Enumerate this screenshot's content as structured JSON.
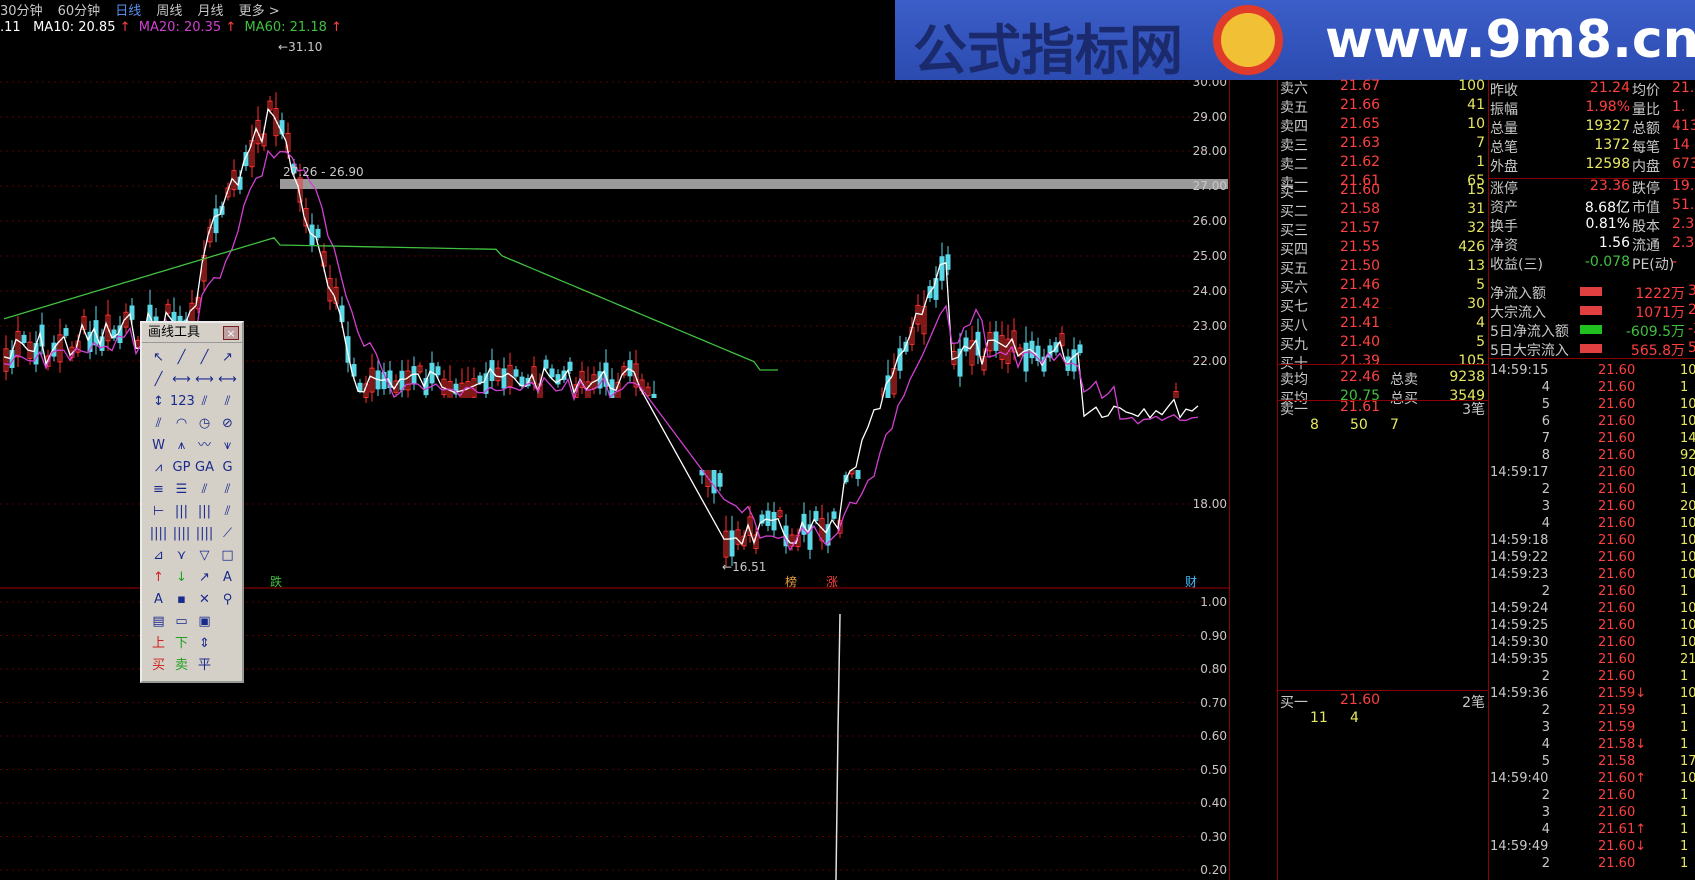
{
  "period_bar": {
    "items": [
      "30分钟",
      "60分钟",
      "日线",
      "周线",
      "月线",
      "更多 >"
    ],
    "active": "日线"
  },
  "ma_legend": {
    "lead": ".11",
    "ma10": "MA10: 20.85",
    "ma20": "MA20: 20.35",
    "ma60": "MA60: 21.18"
  },
  "chart_labels": {
    "high": "31.10",
    "range": "27.26 - 26.90",
    "low": "16.51",
    "mark_1": "跌",
    "mark_2": "榜",
    "mark_3": "涨",
    "mark_4": "财"
  },
  "price_axis": [
    "30.00",
    "29.00",
    "28.00",
    "27.00",
    "26.00",
    "25.00",
    "24.00",
    "23.00",
    "22.00",
    "18.00"
  ],
  "volume_axis": [
    "1.00",
    "0.90",
    "0.80",
    "0.70",
    "0.60",
    "0.50",
    "0.40",
    "0.30",
    "0.20"
  ],
  "banner": {
    "brand": "公式指标网",
    "site": "www.9m8.cn"
  },
  "toolbox": {
    "title": "画线工具",
    "close": "×",
    "tools": [
      "↖",
      "╱",
      "╱",
      "↗",
      "╱",
      "⟷",
      "⟷",
      "⟷",
      "↕",
      "123",
      "⫽",
      "⫽",
      "⫽",
      "◠",
      "◷",
      "⊘",
      "W",
      "⩚",
      "〰",
      "⩛",
      "⩘",
      "GP",
      "GA",
      "G",
      "≡",
      "☰",
      "⫽",
      "⫽",
      "⊢",
      "|||",
      "|||",
      "⫽",
      "||||",
      "||||",
      "||||",
      "⟋",
      "⊿",
      "⋎",
      "▽",
      "□",
      "↑",
      "↓",
      "↗",
      "A",
      "A",
      "▪",
      "✕",
      "⚲",
      "▤",
      "▭",
      "▣",
      "",
      "上",
      "下",
      "⇕",
      "",
      "买",
      "卖",
      "平",
      ""
    ]
  },
  "orderbook": {
    "asks": [
      [
        "卖六",
        "21.67",
        "100"
      ],
      [
        "卖五",
        "21.66",
        "41"
      ],
      [
        "卖四",
        "21.65",
        "10"
      ],
      [
        "卖三",
        "21.63",
        "7"
      ],
      [
        "卖二",
        "21.62",
        "1"
      ],
      [
        "卖一",
        "21.61",
        "65"
      ]
    ],
    "bids": [
      [
        "买一",
        "21.60",
        "15"
      ],
      [
        "买二",
        "21.58",
        "31"
      ],
      [
        "买三",
        "21.57",
        "32"
      ],
      [
        "买四",
        "21.55",
        "426"
      ],
      [
        "买五",
        "21.50",
        "13"
      ],
      [
        "买六",
        "21.46",
        "5"
      ],
      [
        "买七",
        "21.42",
        "30"
      ],
      [
        "买八",
        "21.41",
        "4"
      ],
      [
        "买九",
        "21.40",
        "5"
      ],
      [
        "买十",
        "21.39",
        "105"
      ]
    ],
    "avg_ask_label": "卖均",
    "avg_ask": "22.46",
    "total_ask_label": "总卖",
    "total_ask": "9238",
    "avg_bid_label": "买均",
    "avg_bid": "20.75",
    "total_bid_label": "总买",
    "total_bid": "3549",
    "queue1": {
      "label": "卖一",
      "price": "21.61",
      "count": "3笔",
      "detail": [
        "8",
        "50",
        "7"
      ]
    },
    "queue2": {
      "label": "买一",
      "price": "21.60",
      "count": "2笔",
      "detail": [
        "11",
        "4"
      ]
    }
  },
  "stats": [
    [
      "昨收",
      "21.24",
      "均价",
      "21.4"
    ],
    [
      "振幅",
      "1.98%",
      "量比",
      "1."
    ],
    [
      "总量",
      "19327",
      "总额",
      "4139"
    ],
    [
      "总笔",
      "1372",
      "每笔",
      "14"
    ],
    [
      "外盘",
      "12598",
      "内盘",
      "673"
    ],
    [
      "涨停",
      "23.36",
      "跌停",
      "19."
    ],
    [
      "资产",
      "8.68亿",
      "市值",
      "51.3"
    ],
    [
      "换手",
      "0.81%",
      "股本",
      "2.37"
    ],
    [
      "净资",
      "1.56",
      "流通",
      "2.37"
    ],
    [
      "收益(三)",
      "-0.078",
      "PE(动)",
      "-"
    ]
  ],
  "flows": [
    [
      "净流入额",
      "1222万",
      "30"
    ],
    [
      "大宗流入",
      "1071万",
      "26"
    ],
    [
      "5日净流入额",
      "-609.5万",
      "-3"
    ],
    [
      "5日大宗流入",
      "565.8万",
      "5"
    ]
  ],
  "ticks": [
    [
      "14:59:15",
      "21.60",
      "10"
    ],
    [
      "4",
      "21.60",
      "1"
    ],
    [
      "5",
      "21.60",
      "10"
    ],
    [
      "6",
      "21.60",
      "10"
    ],
    [
      "7",
      "21.60",
      "14"
    ],
    [
      "8",
      "21.60",
      "92"
    ],
    [
      "14:59:17",
      "21.60",
      "10"
    ],
    [
      "2",
      "21.60",
      "1"
    ],
    [
      "3",
      "21.60",
      "20"
    ],
    [
      "4",
      "21.60",
      "10"
    ],
    [
      "14:59:18",
      "21.60",
      "10"
    ],
    [
      "14:59:22",
      "21.60",
      "10"
    ],
    [
      "14:59:23",
      "21.60",
      "10"
    ],
    [
      "2",
      "21.60",
      "1"
    ],
    [
      "14:59:24",
      "21.60",
      "10"
    ],
    [
      "14:59:25",
      "21.60",
      "10"
    ],
    [
      "14:59:30",
      "21.60",
      "10"
    ],
    [
      "14:59:35",
      "21.60",
      "21"
    ],
    [
      "2",
      "21.60",
      "1"
    ],
    [
      "14:59:36",
      "21.59↓",
      "10"
    ],
    [
      "2",
      "21.59",
      "1"
    ],
    [
      "3",
      "21.59",
      "1"
    ],
    [
      "4",
      "21.58↓",
      "1"
    ],
    [
      "5",
      "21.58",
      "17"
    ],
    [
      "14:59:40",
      "21.60↑",
      "10"
    ],
    [
      "2",
      "21.60",
      "1"
    ],
    [
      "3",
      "21.60",
      "1"
    ],
    [
      "4",
      "21.61↑",
      "1"
    ],
    [
      "14:59:49",
      "21.60↓",
      "1"
    ],
    [
      "2",
      "21.60",
      "1"
    ]
  ]
}
